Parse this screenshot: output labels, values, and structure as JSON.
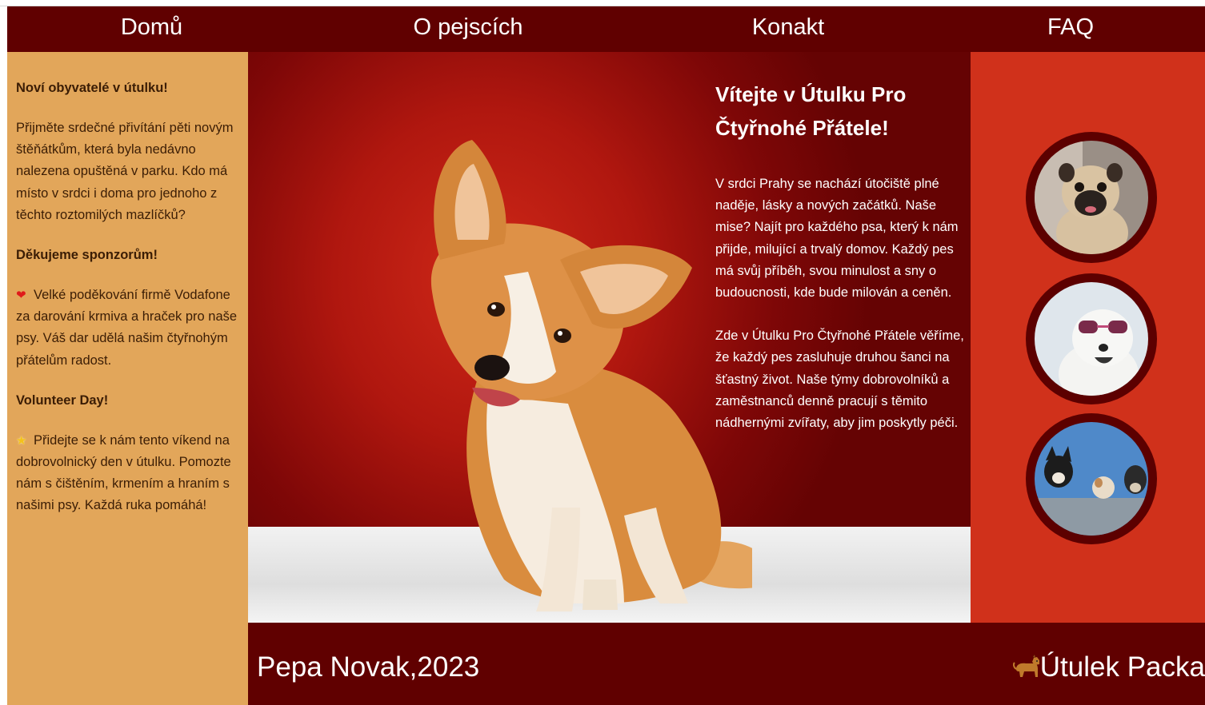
{
  "nav": {
    "items": [
      {
        "label": "Domů"
      },
      {
        "label": "O pejscích"
      },
      {
        "label": "Konakt"
      },
      {
        "label": "FAQ"
      }
    ]
  },
  "sidebar": {
    "news_title": "Noví obyvatelé v útulku!",
    "news_text": "Přijměte srdečné přivítání pěti novým štěňátkům, která byla nedávno nalezena opuštěná v parku. Kdo má místo v srdci i doma pro jednoho z těchto roztomilých mazlíčků?",
    "sponsors_title": "Děkujeme sponzorům!",
    "sponsors_icon": "heart-icon",
    "sponsors_text": "Velké poděkování firmě Vodafone za darování krmiva a hraček pro naše psy. Váš dar udělá našim čtyřnohým přátelům radost.",
    "volunteer_title": "Volunteer Day!",
    "volunteer_icon": "star-icon",
    "volunteer_text": "Přidejte se k nám tento víkend na dobrovolnický den v útulku. Pomozte nám s čištěním, krmením a hraním s našimi psy. Každá ruka pomáhá!"
  },
  "hero": {
    "title": "Vítejte v Útulku Pro Čtyřnohé Přátele!",
    "paragraph1": "V srdci Prahy se nachází útočiště plné naděje, lásky a nových začátků. Naše mise? Najít pro každého psa, který k nám přijde, milující a trvalý domov. Každý pes má svůj příběh, svou minulost a sny o budoucnosti, kde bude milován a ceněn.",
    "paragraph2": "Zde v Útulku Pro Čtyřnohé Přátele věříme, že každý pes zasluhuje druhou šanci na šťastný život. Naše týmy dobrovolníků a zaměstnanců denně pracují s těmito nádhernými zvířaty, aby jim poskytly péči."
  },
  "footer": {
    "author": "Pepa Novak,2023",
    "brand": "Útulek Packa",
    "brand_icon": "dog-icon"
  },
  "colors": {
    "nav": "#600000",
    "sidebar": "#e2a65a",
    "right_panel": "#d0311b",
    "hero": "#b0170f"
  }
}
